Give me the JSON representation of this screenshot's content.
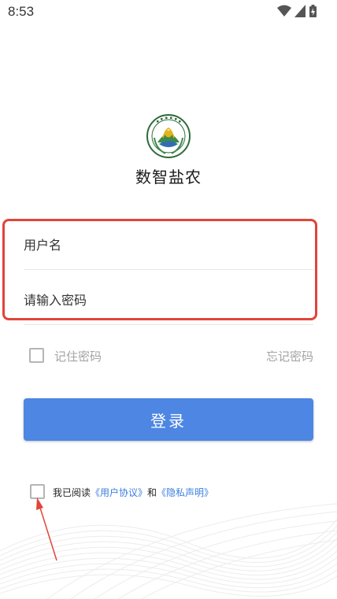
{
  "status_bar": {
    "time": "8:53",
    "icons": [
      "wifi-icon",
      "cellular-signal-icon",
      "battery-charging-icon"
    ]
  },
  "app": {
    "name": "数智盐农",
    "logo_icon": "school-emblem-icon"
  },
  "login_form": {
    "username_placeholder": "用户名",
    "password_placeholder": "请输入密码",
    "remember_label": "记住密码",
    "forgot_label": "忘记密码",
    "submit_label": "登录"
  },
  "agreement": {
    "prefix": "我已阅读",
    "user_agreement": "《用户协议》",
    "conjunction": "和",
    "privacy_policy": "《隐私声明》"
  },
  "colors": {
    "primary": "#4d86e3",
    "link": "#3a7fe0",
    "annotation": "#e2443a",
    "muted_text": "#a3a3a3"
  }
}
